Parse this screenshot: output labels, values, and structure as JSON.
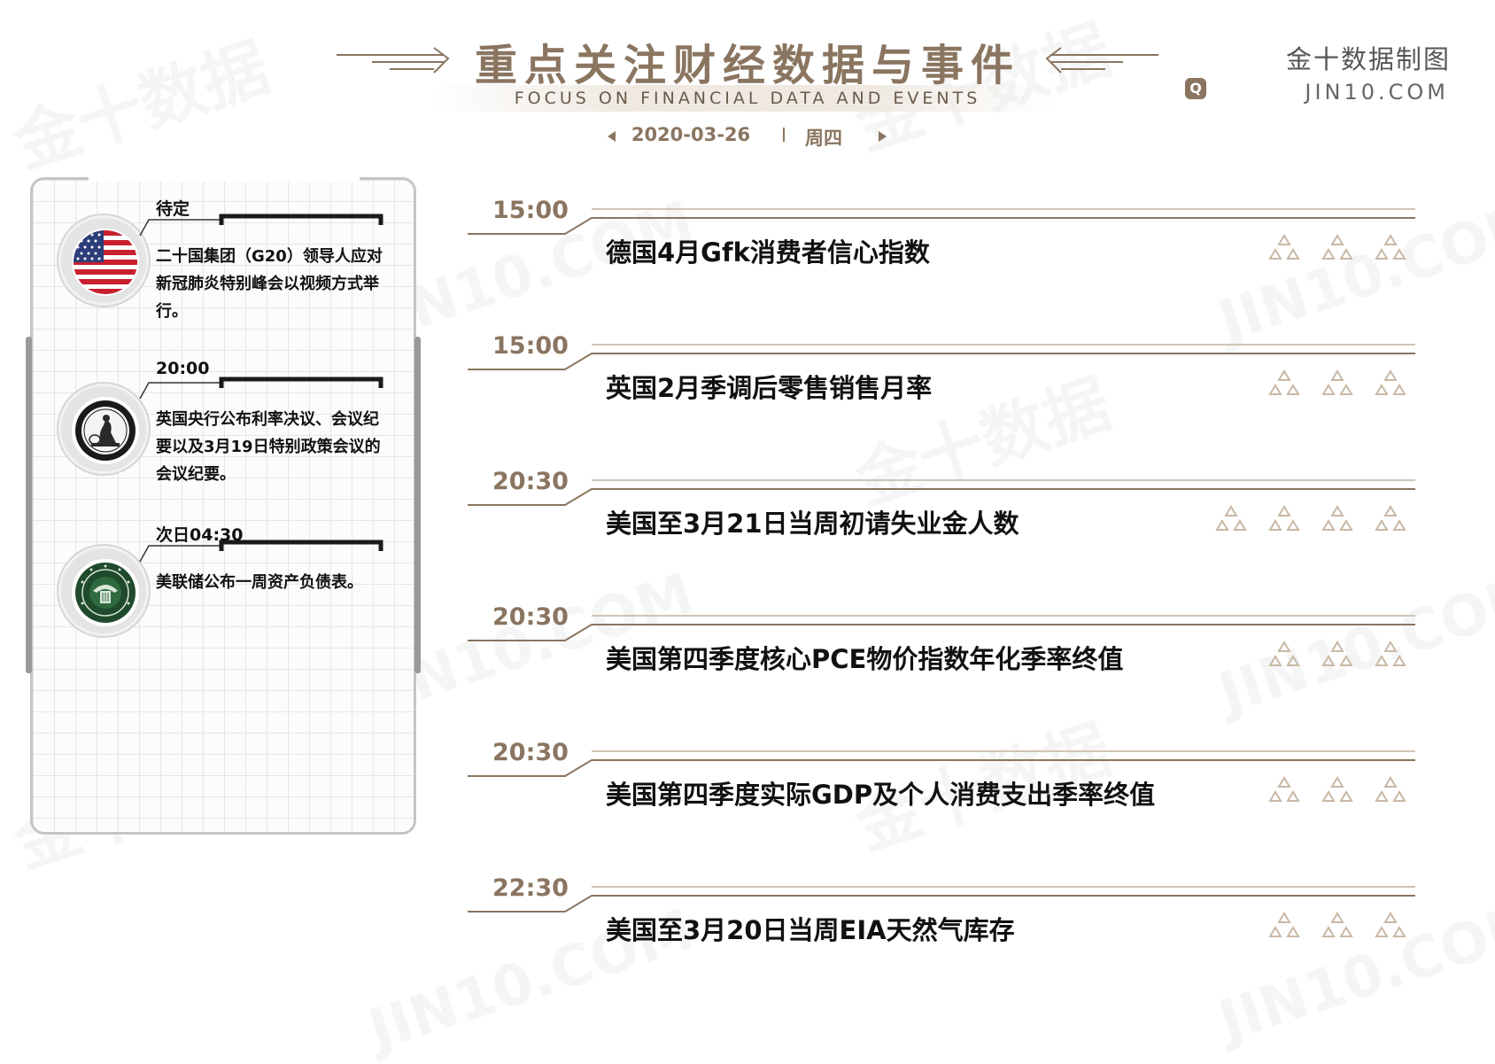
{
  "header": {
    "title": "重点关注财经数据与事件",
    "subtitle": "FOCUS ON FINANCIAL DATA AND EVENTS",
    "date": "2020-03-26",
    "weekday": "周四"
  },
  "brand": {
    "name_cn": "金十数据制图",
    "site": "JIN10.COM"
  },
  "events": [
    {
      "time": "待定",
      "country": "us-flag-icon",
      "description": "二十国集团（G20）领导人应对新冠肺炎特别峰会以视频方式举行。"
    },
    {
      "time": "20:00",
      "country": "bank-of-england-seal-icon",
      "description": "英国央行公布利率决议、会议纪要以及3月19日特别政策会议的会议纪要。"
    },
    {
      "time": "次日04:30",
      "country": "federal-reserve-seal-icon",
      "description": "美联储公布一周资产负债表。"
    }
  ],
  "timeline": [
    {
      "time": "15:00",
      "title": "德国4月Gfk消费者信心指数",
      "importance": 3
    },
    {
      "time": "15:00",
      "title": "英国2月季调后零售销售月率",
      "importance": 3
    },
    {
      "time": "20:30",
      "title": "美国至3月21日当周初请失业金人数",
      "importance": 4
    },
    {
      "time": "20:30",
      "title": "美国第四季度核心PCE物价指数年化季率终值",
      "importance": 3
    },
    {
      "time": "20:30",
      "title": "美国第四季度实际GDP及个人消费支出季率终值",
      "importance": 3
    },
    {
      "time": "22:30",
      "title": "美国至3月20日当周EIA天然气库存",
      "importance": 3
    }
  ],
  "watermark": {
    "cn": "金十数据",
    "en": "JIN10.COM"
  },
  "colors": {
    "accent": "#8a7560",
    "star": "#c9b8a6"
  }
}
